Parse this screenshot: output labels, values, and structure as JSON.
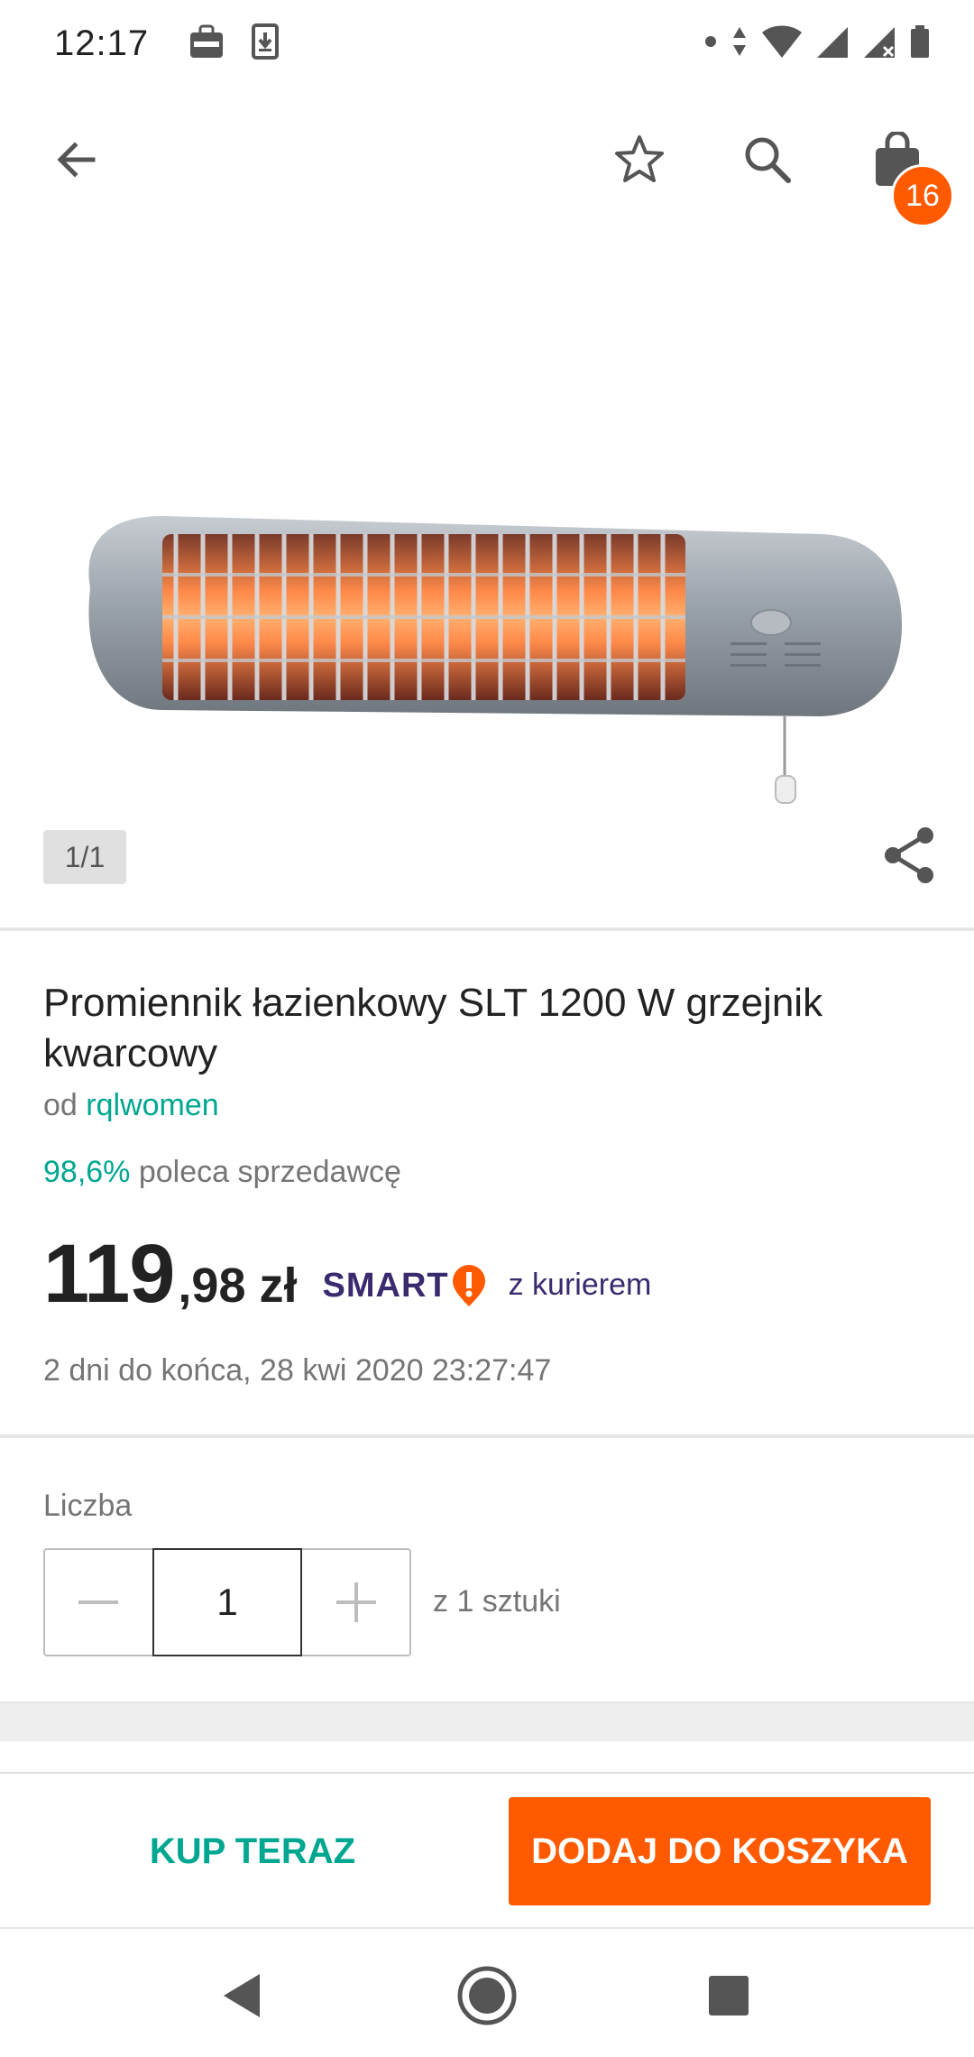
{
  "status_bar": {
    "time": "12:17",
    "icons": [
      "allegro-app-icon",
      "download-icon",
      "dot-icon",
      "data-arrows-icon",
      "wifi-icon",
      "signal-icon",
      "signal-no-sim-icon",
      "battery-icon"
    ]
  },
  "app_bar": {
    "icons": [
      "back-arrow-icon",
      "star-outline-icon",
      "search-icon",
      "cart-bag-icon"
    ],
    "cart_count": "16"
  },
  "gallery": {
    "counter": "1/1",
    "share_icon": "share-icon",
    "image": "quartz-heater-image"
  },
  "product": {
    "title": "Promiennik łazienkowy SLT 1200 W grzejnik kwarcowy",
    "seller_prefix": "od",
    "seller_name": "rqlwomen",
    "rating_pct": "98,6%",
    "rating_text": "poleca sprzedawcę",
    "price_int": "119",
    "price_dec": ",98 zł",
    "smart_label": "SMART",
    "delivery": "z kurierem",
    "end_date": "2 dni do końca, 28 kwi 2020 23:27:47"
  },
  "quantity": {
    "label": "Liczba",
    "value": "1",
    "of_label": "z 1 sztuki"
  },
  "actions": {
    "buy_now": "KUP TERAZ",
    "add_to_cart": "DODAJ DO KOSZYKA"
  },
  "colors": {
    "accent_orange": "#ff5a00",
    "teal": "#00a790",
    "smart_purple": "#3a2a6e"
  }
}
